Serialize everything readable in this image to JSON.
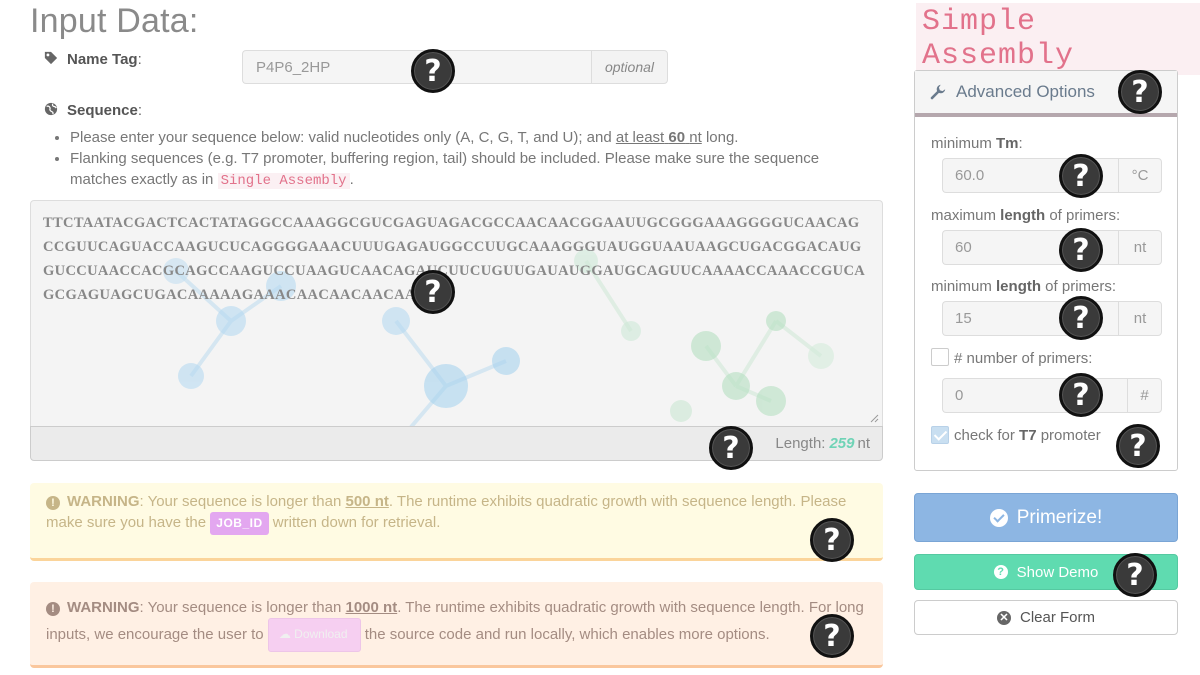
{
  "header": {
    "title": "Input Data:",
    "brand": "Simple Assembly"
  },
  "name_tag": {
    "label": "Name Tag",
    "value": "P4P6_2HP",
    "addon": "optional"
  },
  "sequence": {
    "label": "Sequence",
    "bullet1_a": "Please enter your sequence below: valid nucleotides only (A, C, G, T, and U); and ",
    "bullet1_underline": "at least",
    "bullet1_num": "60",
    "bullet1_unit": "nt",
    "bullet1_end": " long.",
    "bullet2_a": "Flanking sequences (e.g. T7 promoter, buffering region, tail) should be included. Please make sure the sequence matches exactly as in ",
    "bullet2_code": "Single Assembly",
    "bullet2_end": ".",
    "value": "TTCTAATACGACTCACTATAGGCCAAAGGCGUCGAGUAGACGCCAACAACGGAAUUGCGGGAAAGGGGUCAACAGCCGUUCAGUACCAAGUCUCAGGGGAAACUUUGAGAUGGCCUUGCAAAGGGUAUGGUAAUAAGCUGACGGACAUGGUCCUAACCACGCAGCCAAGUCCUAAGUCAACAGAUCUUCUGUUGAUAUGGAUGCAGUUCAAAACCAAACCGUCAGCGAGUAGCUGACAAAAAGAAACAACAACAACAAC",
    "length_label": "Length:",
    "length_value": "259",
    "length_unit": "nt"
  },
  "warnings": [
    {
      "title": "WARNING",
      "text_a": ": Your sequence is longer than ",
      "limit": "500 nt",
      "text_b": ". The runtime exhibits quadratic growth with sequence length. Please make sure you have the ",
      "badge": "JOB_ID",
      "text_c": " written down for retrieval."
    },
    {
      "title": "WARNING",
      "text_a": ": Your sequence is longer than ",
      "limit": "1000 nt",
      "text_b": ". The runtime exhibits quadratic growth with sequence length. For long inputs, we encourage the user to ",
      "button": "Download",
      "text_c": " the source code and run locally, which enables more options."
    }
  ],
  "advanced": {
    "title": "Advanced Options",
    "min_tm": {
      "label_a": "minimum ",
      "label_b": "Tm",
      "label_c": ":",
      "value": "60.0",
      "unit": "°C"
    },
    "max_len": {
      "label_a": "maximum ",
      "label_b": "length",
      "label_c": " of primers:",
      "value": "60",
      "unit": "nt"
    },
    "min_len": {
      "label_a": "minimum ",
      "label_b": "length",
      "label_c": " of primers:",
      "value": "15",
      "unit": "nt"
    },
    "num_primers": {
      "label_a": "# number of primers:",
      "value": "0",
      "unit": "#",
      "checked": false
    },
    "t7": {
      "label_a": "check for ",
      "label_b": "T7",
      "label_c": " promoter",
      "checked": true
    }
  },
  "buttons": {
    "primerize": "Primerize!",
    "demo": "Show Demo",
    "clear": "Clear Form"
  },
  "help_glyph": "?",
  "colors": {
    "accent_pink": "#e2728b",
    "primary_blue": "#8db6e3",
    "demo_green": "#5fdbb0",
    "length_green": "#6fd3b6",
    "warn_yellow_bg": "#fffbe3",
    "warn_orange_bg": "#fff0e4"
  }
}
